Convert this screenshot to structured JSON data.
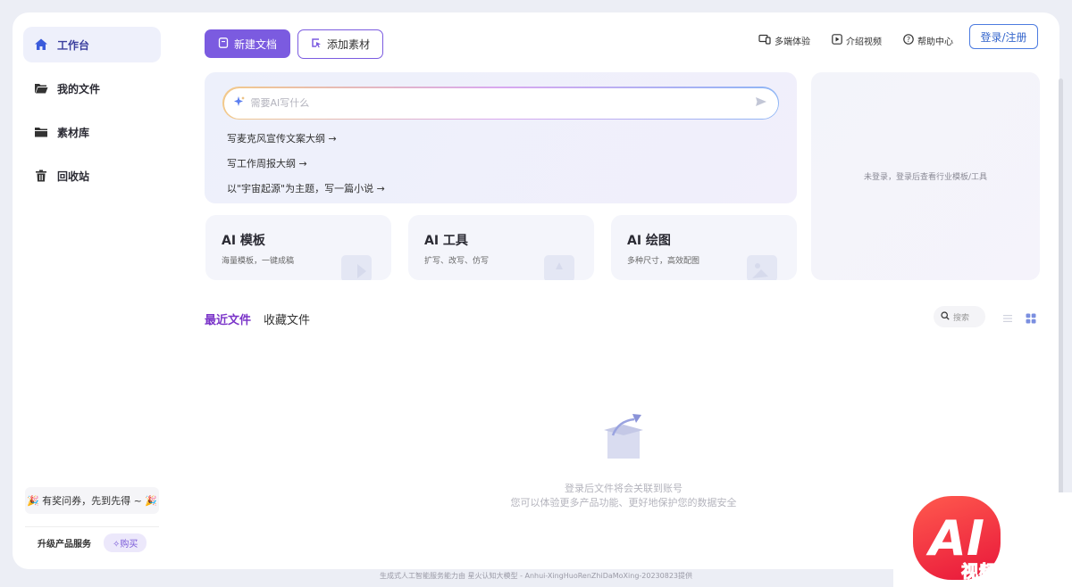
{
  "sidebar": {
    "items": [
      {
        "label": "工作台",
        "icon": "home-icon",
        "active": true
      },
      {
        "label": "我的文件",
        "icon": "folder-open-icon",
        "active": false
      },
      {
        "label": "素材库",
        "icon": "folder-icon",
        "active": false
      },
      {
        "label": "回收站",
        "icon": "trash-icon",
        "active": false
      }
    ],
    "promo": "🎉 有奖问券，先到先得 ~ 🎉",
    "upgrade_label": "升级产品服务",
    "buy_label": "购买"
  },
  "toolbar": {
    "new_doc_label": "新建文档",
    "add_material_label": "添加素材",
    "links": [
      {
        "label": "多端体验",
        "icon": "devices-icon"
      },
      {
        "label": "介绍视频",
        "icon": "play-icon"
      },
      {
        "label": "帮助中心",
        "icon": "help-icon"
      }
    ],
    "login_label": "登录/注册"
  },
  "ai_writer": {
    "placeholder": "需要AI写什么",
    "suggestions": [
      "写麦克风宣传文案大纲 →",
      "写工作周报大纲 →",
      "以\"宇宙起源\"为主题，写一篇小说 →"
    ]
  },
  "right_panel": {
    "message": "未登录，登录后查看行业模板/工具"
  },
  "cards": [
    {
      "title": "AI 模板",
      "subtitle": "海量模板，一键成稿"
    },
    {
      "title": "AI 工具",
      "subtitle": "扩写、改写、仿写"
    },
    {
      "title": "AI 绘图",
      "subtitle": "多种尺寸，高效配图"
    }
  ],
  "files": {
    "tabs": [
      "最近文件",
      "收藏文件"
    ],
    "search_placeholder": "搜索",
    "empty_line1": "登录后文件将会关联到账号",
    "empty_line2": "您可以体验更多产品功能、更好地保护您的数据安全"
  },
  "footer": "生成式人工智能服务能力由 星火认知大模型 - Anhui-XingHuoRenZhiDaMoXing-20230823提供",
  "watermark": {
    "badge": "AI",
    "text": "视频贴吧"
  },
  "colors": {
    "accent": "#7b5be0",
    "login_border": "#4c7be0",
    "active_tab": "#7b35c9",
    "background": "#eceef5"
  }
}
